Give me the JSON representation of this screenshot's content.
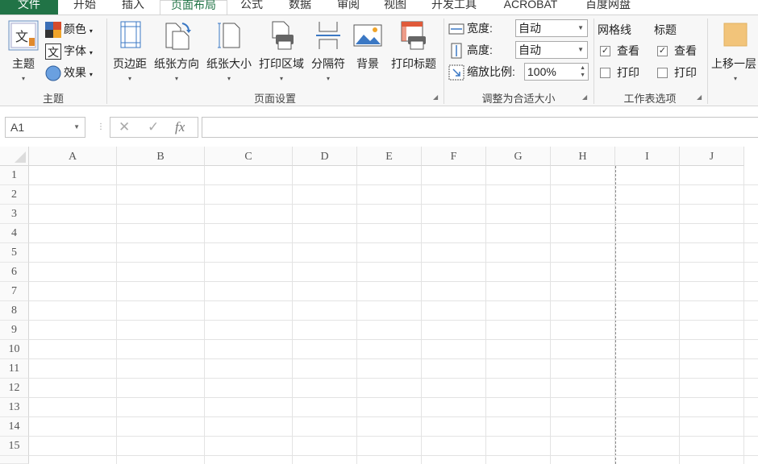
{
  "tabs": [
    "文件",
    "开始",
    "插入",
    "页面布局",
    "公式",
    "数据",
    "审阅",
    "视图",
    "开发工具",
    "ACROBAT",
    "百度网盘"
  ],
  "active_tab": "页面布局",
  "ribbon": {
    "theme": {
      "theme_label": "主题",
      "colors_label": "颜色",
      "fonts_label": "字体",
      "effects_label": "效果",
      "group_label": "主题"
    },
    "page_setup": {
      "margins": "页边距",
      "orientation": "纸张方向",
      "size": "纸张大小",
      "print_area": "打印区域",
      "breaks": "分隔符",
      "background": "背景",
      "print_titles": "打印标题",
      "group_label": "页面设置"
    },
    "scale_to_fit": {
      "width_label": "宽度:",
      "width_value": "自动",
      "height_label": "高度:",
      "height_value": "自动",
      "scale_label": "缩放比例:",
      "scale_value": "100%",
      "group_label": "调整为合适大小"
    },
    "sheet_options": {
      "gridlines_label": "网格线",
      "headings_label": "标题",
      "view_label": "查看",
      "print_label": "打印",
      "gridlines_view": true,
      "gridlines_print": false,
      "headings_view": true,
      "headings_print": false,
      "group_label": "工作表选项"
    },
    "arrange": {
      "bring_forward": "上移一层"
    }
  },
  "formula_bar": {
    "name_box": "A1",
    "cancel": "✕",
    "enter": "✓",
    "fx": "fx",
    "value": ""
  },
  "sheet": {
    "columns": [
      "A",
      "B",
      "C",
      "D",
      "E",
      "F",
      "G",
      "H",
      "I",
      "J"
    ],
    "rows": [
      "1",
      "2",
      "3",
      "4",
      "5",
      "6",
      "7",
      "8",
      "9",
      "10",
      "11",
      "12",
      "13",
      "14",
      "15"
    ]
  },
  "colors": {
    "accent": "#217346",
    "page_break": "#8a8a8a"
  }
}
